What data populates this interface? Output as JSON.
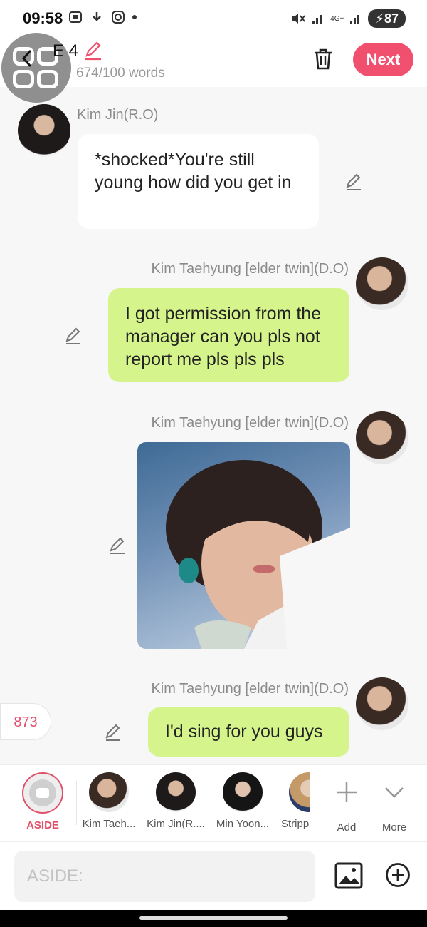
{
  "status_bar": {
    "time": "09:58",
    "battery": "87",
    "network": "4G+"
  },
  "header": {
    "title": "E 4",
    "word_count": "674/100 words",
    "next_label": "Next"
  },
  "messages": [
    {
      "sender": "Kim Jin(R.O)",
      "text": "*shocked*You're still young how did you get in",
      "side": "left"
    },
    {
      "sender": "Kim Taehyung [elder twin](D.O)",
      "text": "I got permission from the manager can you pls not report me pls pls pls",
      "side": "right"
    },
    {
      "sender": "Kim Taehyung [elder twin](D.O)",
      "text": "",
      "type": "image",
      "side": "right"
    },
    {
      "sender": "Kim Taehyung [elder twin](D.O)",
      "text": "I'd sing for you guys",
      "side": "right"
    }
  ],
  "counter": "873",
  "characters": {
    "aside_label": "ASIDE",
    "items": [
      "Kim Taeh...",
      "Kim Jin(R....",
      "Min Yoon...",
      "Stripp"
    ],
    "add_label": "Add",
    "more_label": "More"
  },
  "input": {
    "placeholder": "ASIDE:"
  },
  "colors": {
    "accent": "#f0506e",
    "green_bubble": "#d5f48c"
  }
}
